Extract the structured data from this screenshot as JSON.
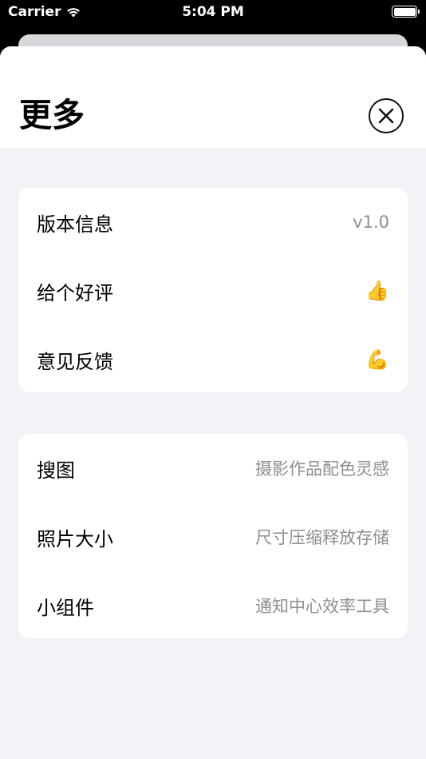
{
  "status_bar": {
    "carrier": "Carrier",
    "time": "5:04 PM"
  },
  "sheet": {
    "title": "更多",
    "close_icon": "close-circle-icon"
  },
  "group1": [
    {
      "label": "版本信息",
      "value": "v1.0"
    },
    {
      "label": "给个好评",
      "value": "👍"
    },
    {
      "label": "意见反馈",
      "value": "💪"
    }
  ],
  "group2": [
    {
      "label": "搜图",
      "value": "摄影作品配色灵感"
    },
    {
      "label": "照片大小",
      "value": "尺寸压缩释放存储"
    },
    {
      "label": "小组件",
      "value": "通知中心效率工具"
    }
  ],
  "colors": {
    "background": "#f2f2f7",
    "card": "#ffffff",
    "secondary_text": "#8e8e93"
  }
}
